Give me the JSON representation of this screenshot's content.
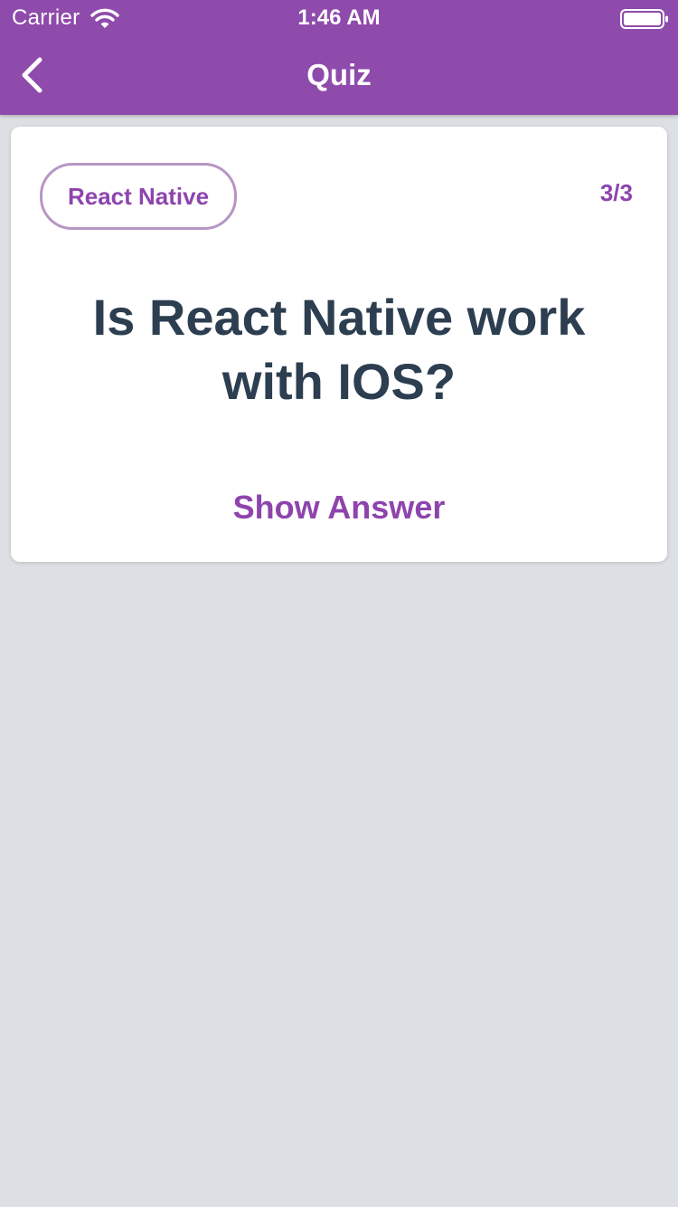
{
  "status_bar": {
    "carrier": "Carrier",
    "time": "1:46 AM",
    "wifi_icon": "wifi-icon",
    "battery_icon": "battery-icon"
  },
  "nav": {
    "title": "Quiz",
    "back_icon": "chevron-left-icon"
  },
  "card": {
    "deck": "React Native",
    "progress": "3/3",
    "question": "Is React Native work with IOS?",
    "action_label": "Show Answer"
  },
  "colors": {
    "header": "#8e4bab",
    "accent": "#8e44ad",
    "question_text": "#2c3e50",
    "background": "#dcdfe3",
    "card": "#ffffff"
  }
}
